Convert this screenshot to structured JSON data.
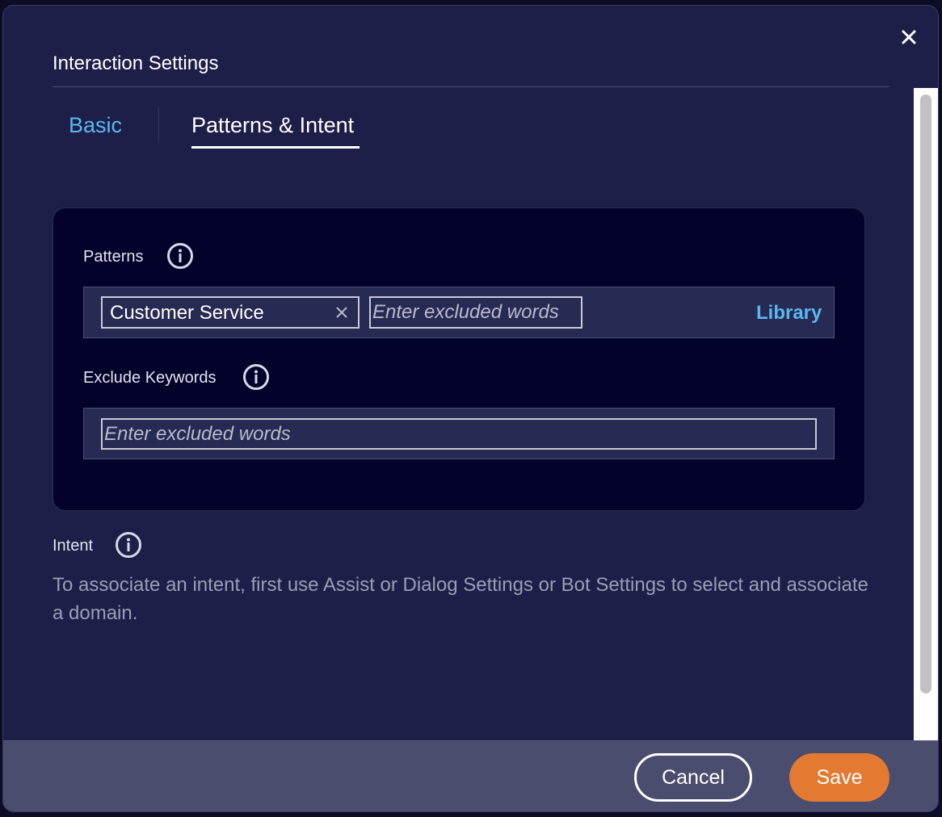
{
  "dialog": {
    "title": "Interaction Settings",
    "close_icon": "close-icon"
  },
  "tabs": [
    {
      "label": "Basic",
      "active": false
    },
    {
      "label": "Patterns & Intent",
      "active": true
    }
  ],
  "patterns": {
    "label": "Patterns",
    "info_icon": "info-icon",
    "chips": [
      {
        "text": "Customer Service",
        "remove_icon": "close-icon"
      }
    ],
    "placeholder": "Enter excluded words",
    "library_label": "Library"
  },
  "exclude_keywords": {
    "label": "Exclude Keywords",
    "info_icon": "info-icon",
    "placeholder": "Enter excluded words"
  },
  "intent": {
    "label": "Intent",
    "info_icon": "info-icon",
    "description": "To associate an intent, first use Assist or Dialog Settings or Bot Settings to select and associate a domain."
  },
  "footer": {
    "cancel_label": "Cancel",
    "save_label": "Save"
  },
  "colors": {
    "accent": "#5ab8f0",
    "save_button": "#e47a31",
    "dialog_bg": "#1d1f48",
    "panel_bg": "#02022a"
  }
}
